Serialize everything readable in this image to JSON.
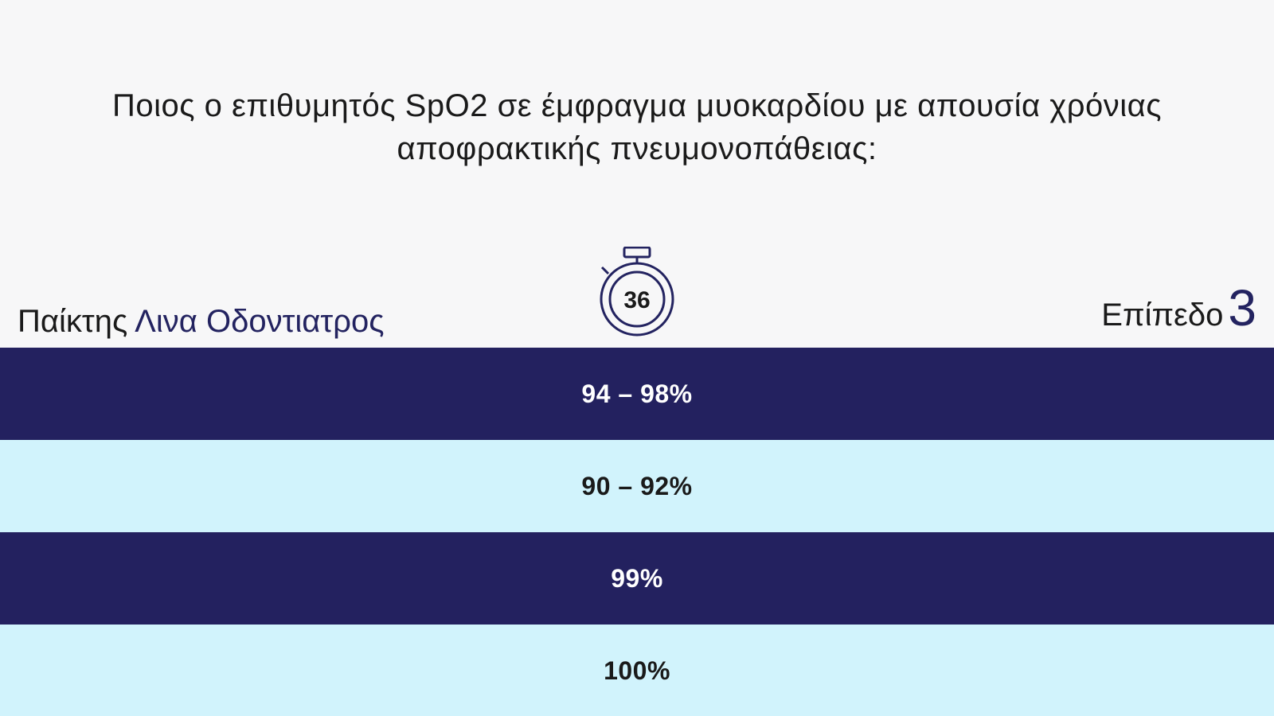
{
  "question": {
    "line1": "Ποιος ο επιθυμητός SpO2 σε έμφραγμα μυοκαρδίου με απουσία χρόνιας",
    "line2": "αποφρακτικής πνευμονοπάθειας:"
  },
  "player": {
    "label": "Παίκτης",
    "name": "Λινα Οδοντιατρος"
  },
  "timer": {
    "seconds": "36",
    "icon": "stopwatch-icon"
  },
  "level": {
    "label": "Επίπεδο",
    "number": "3"
  },
  "answers": [
    {
      "text": "94 – 98%",
      "style": "dark",
      "color": "#23215f"
    },
    {
      "text": "90 – 92%",
      "style": "light",
      "color": "#d1f3fc"
    },
    {
      "text": "99%",
      "style": "dark",
      "color": "#23215f"
    },
    {
      "text": "100%",
      "style": "light",
      "color": "#d1f3fc"
    }
  ],
  "colors": {
    "accent": "#23215f",
    "light_row": "#d1f3fc",
    "background": "#f7f7f8"
  }
}
